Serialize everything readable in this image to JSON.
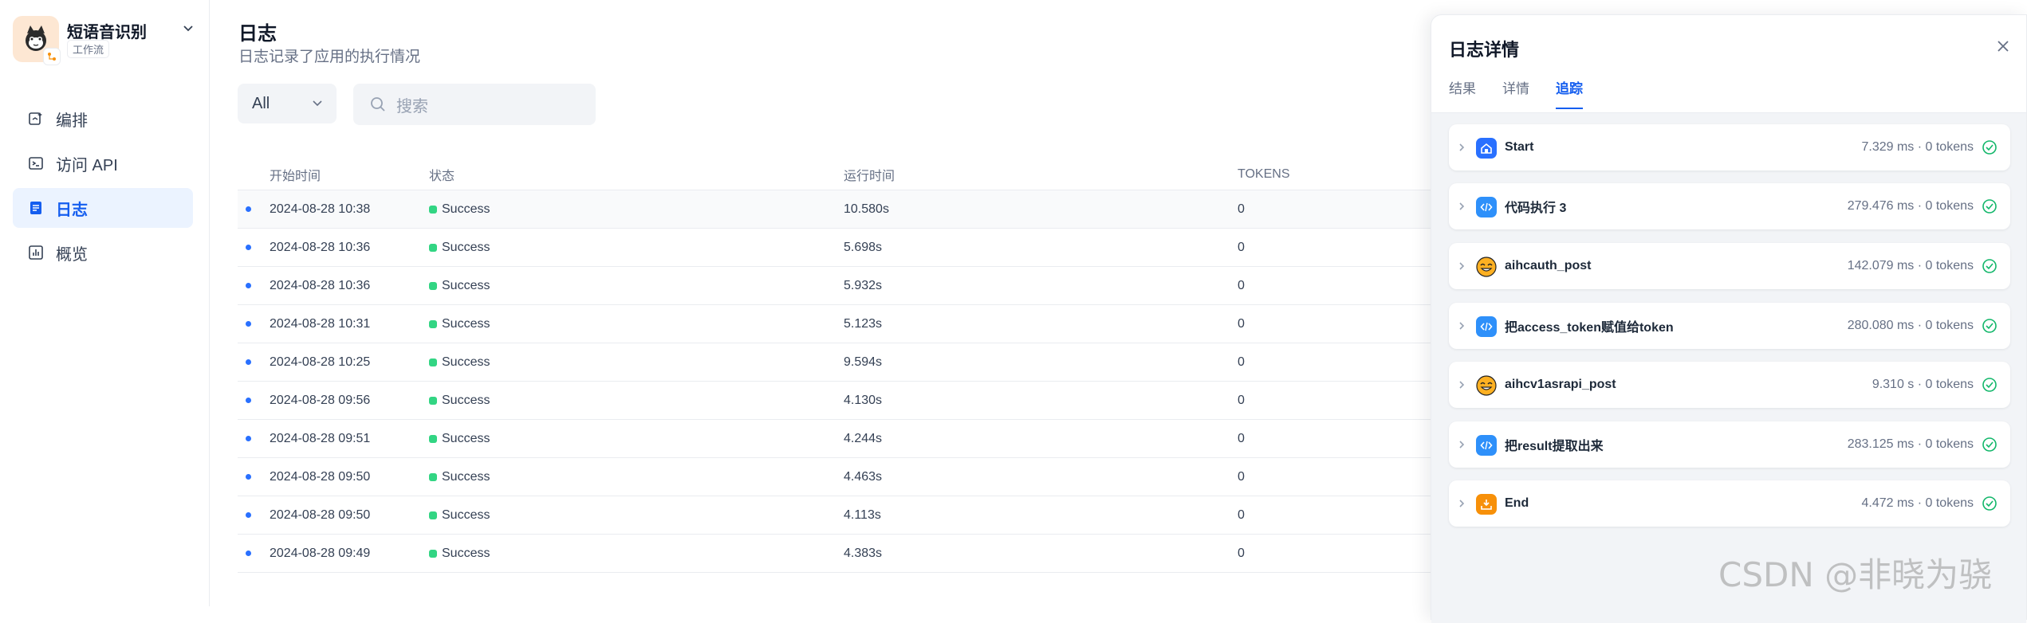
{
  "app": {
    "name": "短语音识别",
    "type": "工作流"
  },
  "sidebar": {
    "items": [
      {
        "label": "编排",
        "icon": "orchestrate-icon",
        "active": false
      },
      {
        "label": "访问 API",
        "icon": "terminal-icon",
        "active": false
      },
      {
        "label": "日志",
        "icon": "log-icon",
        "active": true
      },
      {
        "label": "概览",
        "icon": "chart-icon",
        "active": false
      }
    ]
  },
  "main": {
    "title": "日志",
    "subtitle": "日志记录了应用的执行情况",
    "filter": {
      "value": "All"
    },
    "search": {
      "placeholder": "搜索"
    },
    "columns": [
      "开始时间",
      "状态",
      "运行时间",
      "TOKENS"
    ],
    "rows": [
      {
        "start": "2024-08-28 10:38",
        "status": "Success",
        "runtime": "10.580s",
        "tokens": "0"
      },
      {
        "start": "2024-08-28 10:36",
        "status": "Success",
        "runtime": "5.698s",
        "tokens": "0"
      },
      {
        "start": "2024-08-28 10:36",
        "status": "Success",
        "runtime": "5.932s",
        "tokens": "0"
      },
      {
        "start": "2024-08-28 10:31",
        "status": "Success",
        "runtime": "5.123s",
        "tokens": "0"
      },
      {
        "start": "2024-08-28 10:25",
        "status": "Success",
        "runtime": "9.594s",
        "tokens": "0"
      },
      {
        "start": "2024-08-28 09:56",
        "status": "Success",
        "runtime": "4.130s",
        "tokens": "0"
      },
      {
        "start": "2024-08-28 09:51",
        "status": "Success",
        "runtime": "4.244s",
        "tokens": "0"
      },
      {
        "start": "2024-08-28 09:50",
        "status": "Success",
        "runtime": "4.463s",
        "tokens": "0"
      },
      {
        "start": "2024-08-28 09:50",
        "status": "Success",
        "runtime": "4.113s",
        "tokens": "0"
      },
      {
        "start": "2024-08-28 09:49",
        "status": "Success",
        "runtime": "4.383s",
        "tokens": "0"
      }
    ]
  },
  "panel": {
    "title": "日志详情",
    "tabs": [
      {
        "label": "结果",
        "active": false
      },
      {
        "label": "详情",
        "active": false
      },
      {
        "label": "追踪",
        "active": true
      }
    ],
    "nodes": [
      {
        "name": "Start",
        "meta": "7.329 ms · 0 tokens",
        "icon": "home-icon",
        "color": "#2970ff"
      },
      {
        "name": "代码执行 3",
        "meta": "279.476 ms · 0 tokens",
        "icon": "code-icon",
        "color": "#2e90fa"
      },
      {
        "name": "aihcauth_post",
        "meta": "142.079 ms · 0 tokens",
        "icon": "emoji-icon",
        "color": "#fdb022"
      },
      {
        "name": "把access_token赋值给token",
        "meta": "280.080 ms · 0 tokens",
        "icon": "code-icon",
        "color": "#2e90fa"
      },
      {
        "name": "aihcv1asrapi_post",
        "meta": "9.310 s · 0 tokens",
        "icon": "emoji-icon",
        "color": "#fdb022"
      },
      {
        "name": "把result提取出来",
        "meta": "283.125 ms · 0 tokens",
        "icon": "code-icon",
        "color": "#2e90fa"
      },
      {
        "name": "End",
        "meta": "4.472 ms · 0 tokens",
        "icon": "end-icon",
        "color": "#f79009"
      }
    ]
  },
  "watermark": "CSDN @非晓为骁",
  "colors": {
    "accent": "#155eef",
    "success": "#32d583",
    "active_nav_bg": "#ebf3ff"
  }
}
